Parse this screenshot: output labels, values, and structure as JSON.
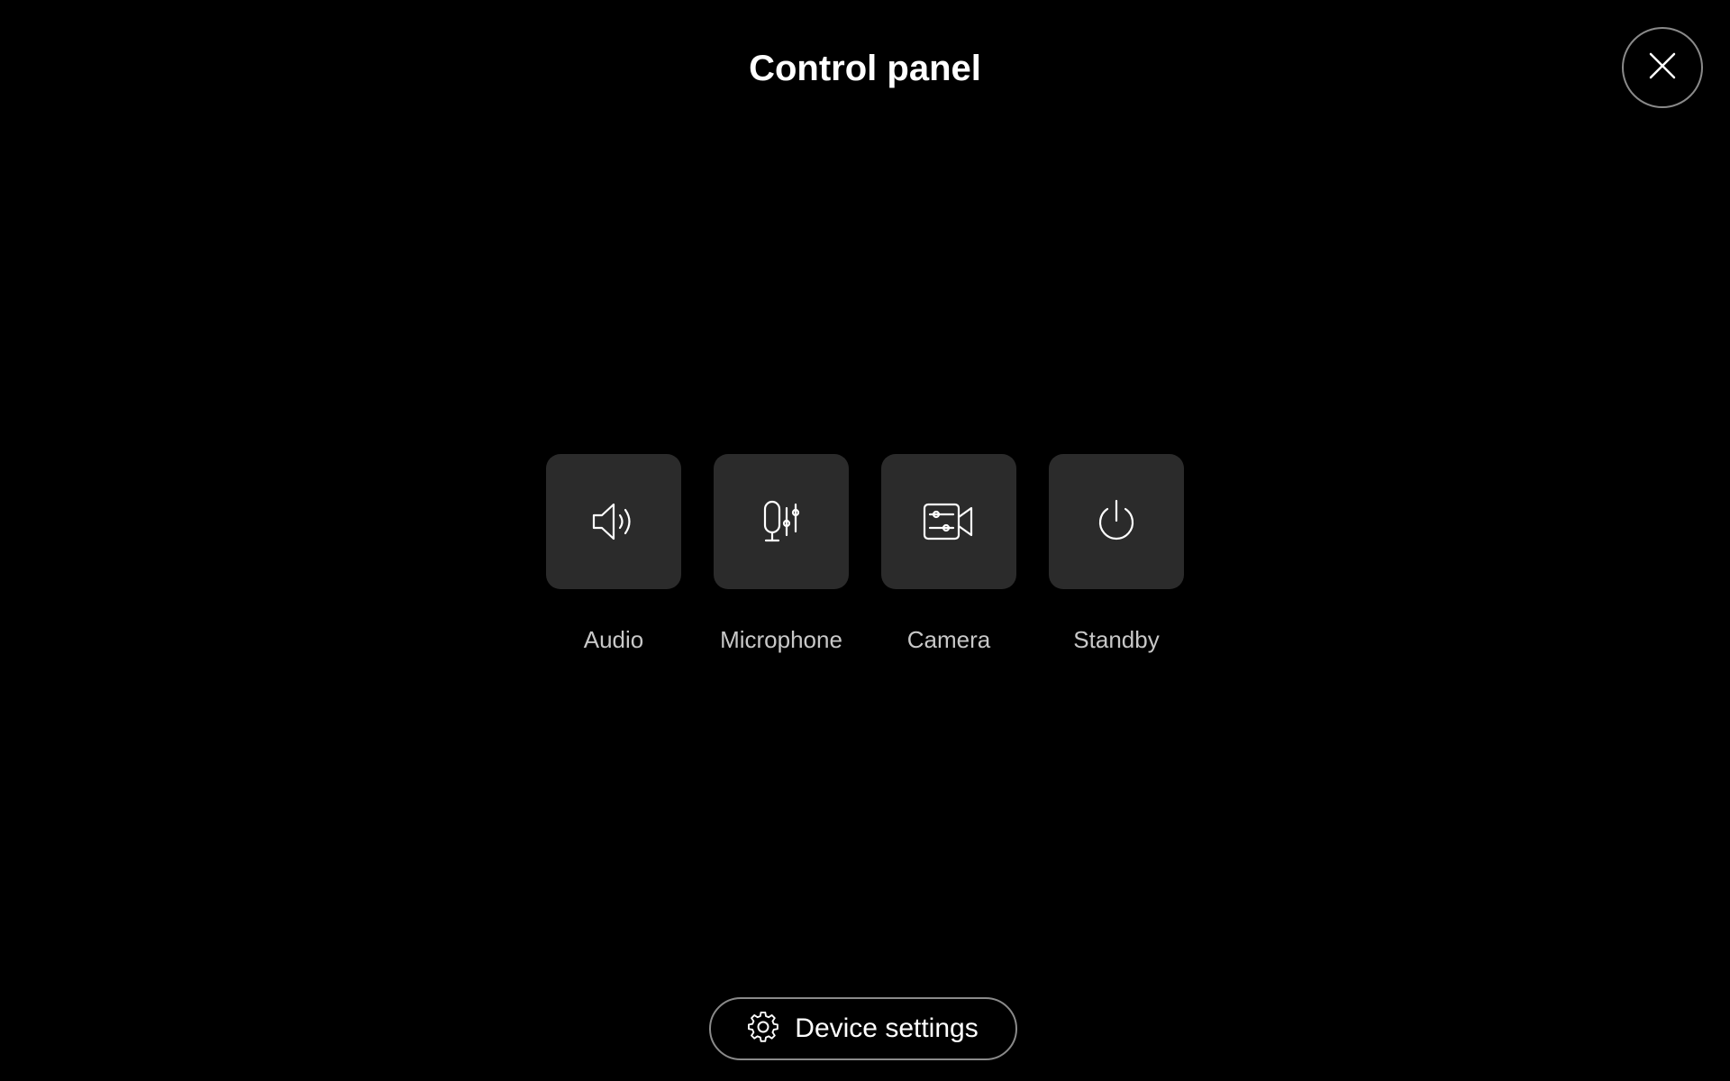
{
  "header": {
    "title": "Control panel",
    "close_icon": "close-icon"
  },
  "controls": [
    {
      "label": "Audio",
      "icon": "speaker-icon"
    },
    {
      "label": "Microphone",
      "icon": "microphone-settings-icon"
    },
    {
      "label": "Camera",
      "icon": "camera-settings-icon"
    },
    {
      "label": "Standby",
      "icon": "power-icon"
    }
  ],
  "footer": {
    "device_settings_label": "Device settings",
    "icon": "gear-icon"
  },
  "colors": {
    "background": "#000000",
    "tile": "#2b2b2b",
    "label": "#c8c8c8",
    "border": "#8a8a8a",
    "text": "#ffffff"
  }
}
